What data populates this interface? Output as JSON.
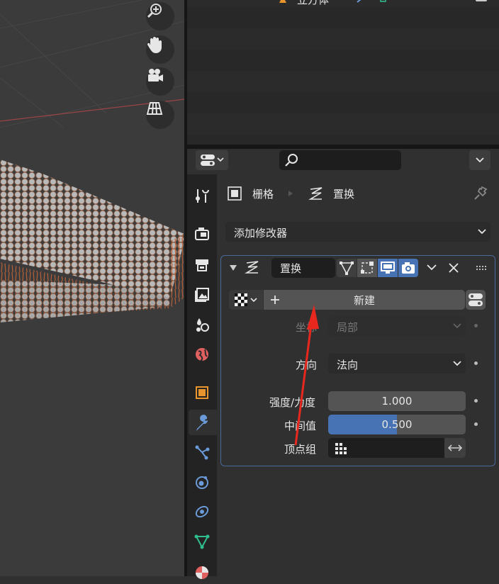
{
  "outliner": {
    "top_label": "立方体"
  },
  "properties": {
    "search_placeholder": "",
    "breadcrumb": {
      "object": "栅格",
      "modifier": "置换"
    },
    "add_modifier": "添加修改器",
    "modifier": {
      "name": "置换",
      "texture_new": "新建",
      "coords_label": "坐标",
      "coords_value": "局部",
      "direction_label": "方向",
      "direction_value": "法向",
      "strength_label": "强度/力度",
      "strength_value": "1.000",
      "midlevel_label": "中间值",
      "midlevel_value": "0.500",
      "midlevel_fraction": 0.5,
      "vgroup_label": "顶点组",
      "vgroup_value": ""
    }
  },
  "colors": {
    "accent_blue": "#4772b3",
    "annotation_arrow": "#e8281e",
    "panel_border": "#4a6a9a"
  },
  "icons": [
    "zoom-icon",
    "hand-icon",
    "camera-icon",
    "grid-icon",
    "wrench-icon",
    "render-icon",
    "output-icon",
    "view-layer-icon",
    "scene-icon",
    "world-icon",
    "object-icon",
    "modifier-icon",
    "particles-icon",
    "physics-icon",
    "constraint-icon",
    "data-icon",
    "material-icon",
    "search-icon",
    "pin-icon",
    "checker-icon"
  ]
}
